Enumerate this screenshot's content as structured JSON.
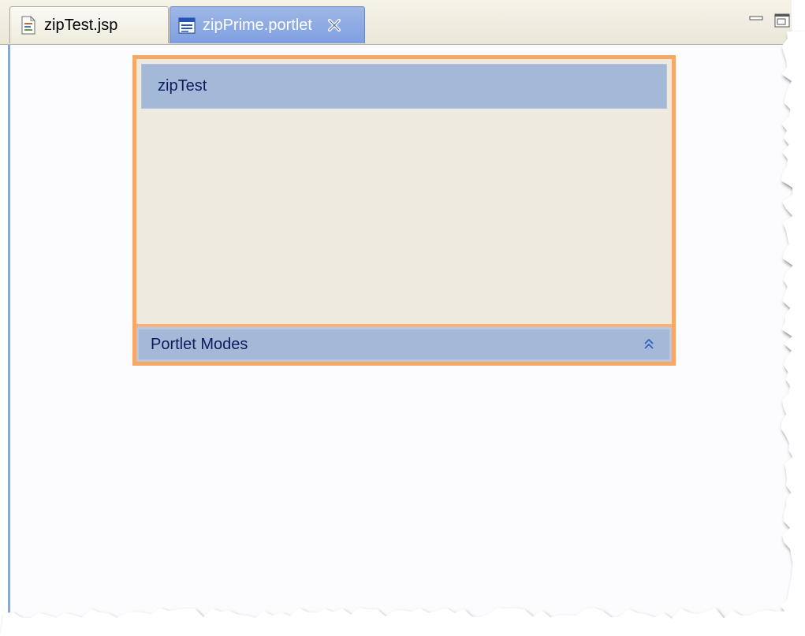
{
  "tabs": [
    {
      "label": "zipTest.jsp",
      "icon": "jsp-file-icon",
      "active": false
    },
    {
      "label": "zipPrime.portlet",
      "icon": "portlet-file-icon",
      "active": true
    }
  ],
  "portlet": {
    "title": "zipTest",
    "modes_label": "Portlet Modes",
    "collapse_icon": "double-chevron-up-icon"
  },
  "window_controls": [
    "minimize-icon",
    "maximize-icon"
  ],
  "colors": {
    "active_tab": "#7e9fe0",
    "portlet_border": "#f8a866",
    "portlet_header": "#a4b8d8",
    "portlet_body": "#efeadf",
    "header_text": "#0b1d5c"
  }
}
